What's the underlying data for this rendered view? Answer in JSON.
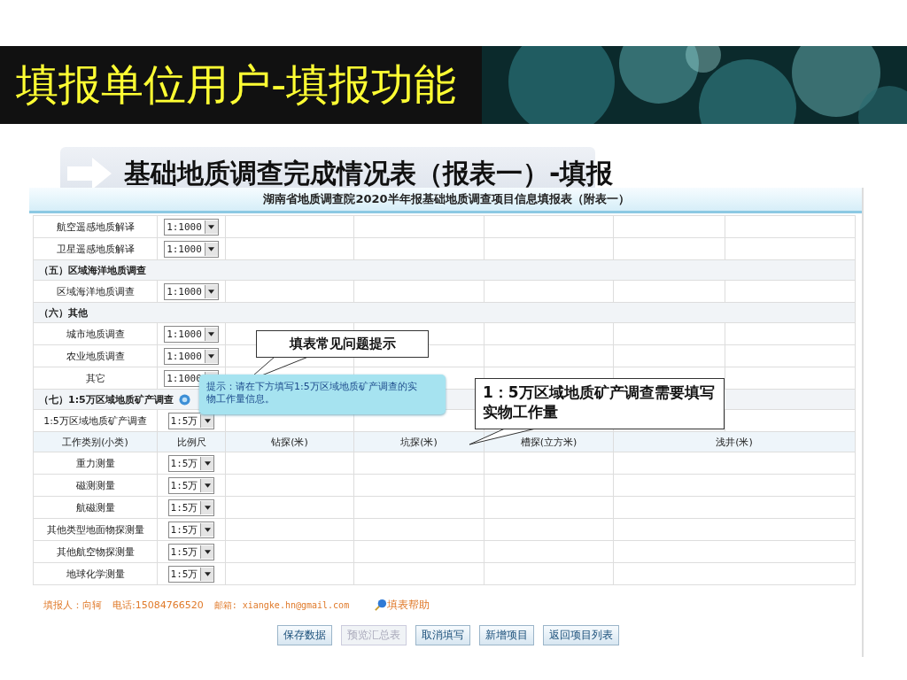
{
  "slide": {
    "title": "填报单位用户-填报功能",
    "subtitle": "基础地质调查完成情况表（报表一）-填报"
  },
  "form": {
    "title": "湖南省地质调查院2020半年报基础地质调查项目信息填报表（附表一）",
    "rows": [
      {
        "kind": "item",
        "label": "航空遥感地质解译",
        "scale": "1:1000"
      },
      {
        "kind": "item",
        "label": "卫星遥感地质解译",
        "scale": "1:1000"
      },
      {
        "kind": "section",
        "label": "（五）区域海洋地质调查",
        "help": false
      },
      {
        "kind": "item",
        "label": "区域海洋地质调查",
        "scale": "1:1000"
      },
      {
        "kind": "section",
        "label": "（六）其他",
        "help": false
      },
      {
        "kind": "item",
        "label": "城市地质调查",
        "scale": "1:1000"
      },
      {
        "kind": "item",
        "label": "农业地质调查",
        "scale": "1:1000"
      },
      {
        "kind": "item",
        "label": "其它",
        "scale": "1:1000"
      },
      {
        "kind": "section",
        "label": "（七）1:5万区域地质矿产调查",
        "help": true
      },
      {
        "kind": "item",
        "label": "1:5万区域地质矿产调查",
        "scale": "1:5万"
      },
      {
        "kind": "header",
        "cells": [
          "工作类别(小类)",
          "比例尺",
          "钻探(米)",
          "坑探(米)",
          "槽探(立方米)",
          "浅井(米)"
        ]
      },
      {
        "kind": "work",
        "label": "重力测量",
        "scale": "1:5万"
      },
      {
        "kind": "work",
        "label": "磁测测量",
        "scale": "1:5万"
      },
      {
        "kind": "work",
        "label": "航磁测量",
        "scale": "1:5万"
      },
      {
        "kind": "work",
        "label": "其他类型地面物探测量",
        "scale": "1:5万"
      },
      {
        "kind": "work",
        "label": "其他航空物探测量",
        "scale": "1:5万"
      },
      {
        "kind": "work",
        "label": "地球化学测量",
        "scale": "1:5万"
      }
    ]
  },
  "tooltip": "提示：请在下方填写1:5万区域地质矿产调查的实物工作量信息。",
  "callouts": [
    "填表常见问题提示",
    "1：5万区域地质矿产调查需要填写实物工作量"
  ],
  "footer": {
    "reporter": "填报人：向轲",
    "phone": "电话:15084766520",
    "email": "邮箱: xiangke.hn@gmail.com",
    "help_link": "填表帮助"
  },
  "buttons": [
    {
      "label": "保存数据",
      "disabled": false
    },
    {
      "label": "预览汇总表",
      "disabled": true
    },
    {
      "label": "取消填写",
      "disabled": false
    },
    {
      "label": "新增项目",
      "disabled": false
    },
    {
      "label": "返回项目列表",
      "disabled": false
    }
  ]
}
